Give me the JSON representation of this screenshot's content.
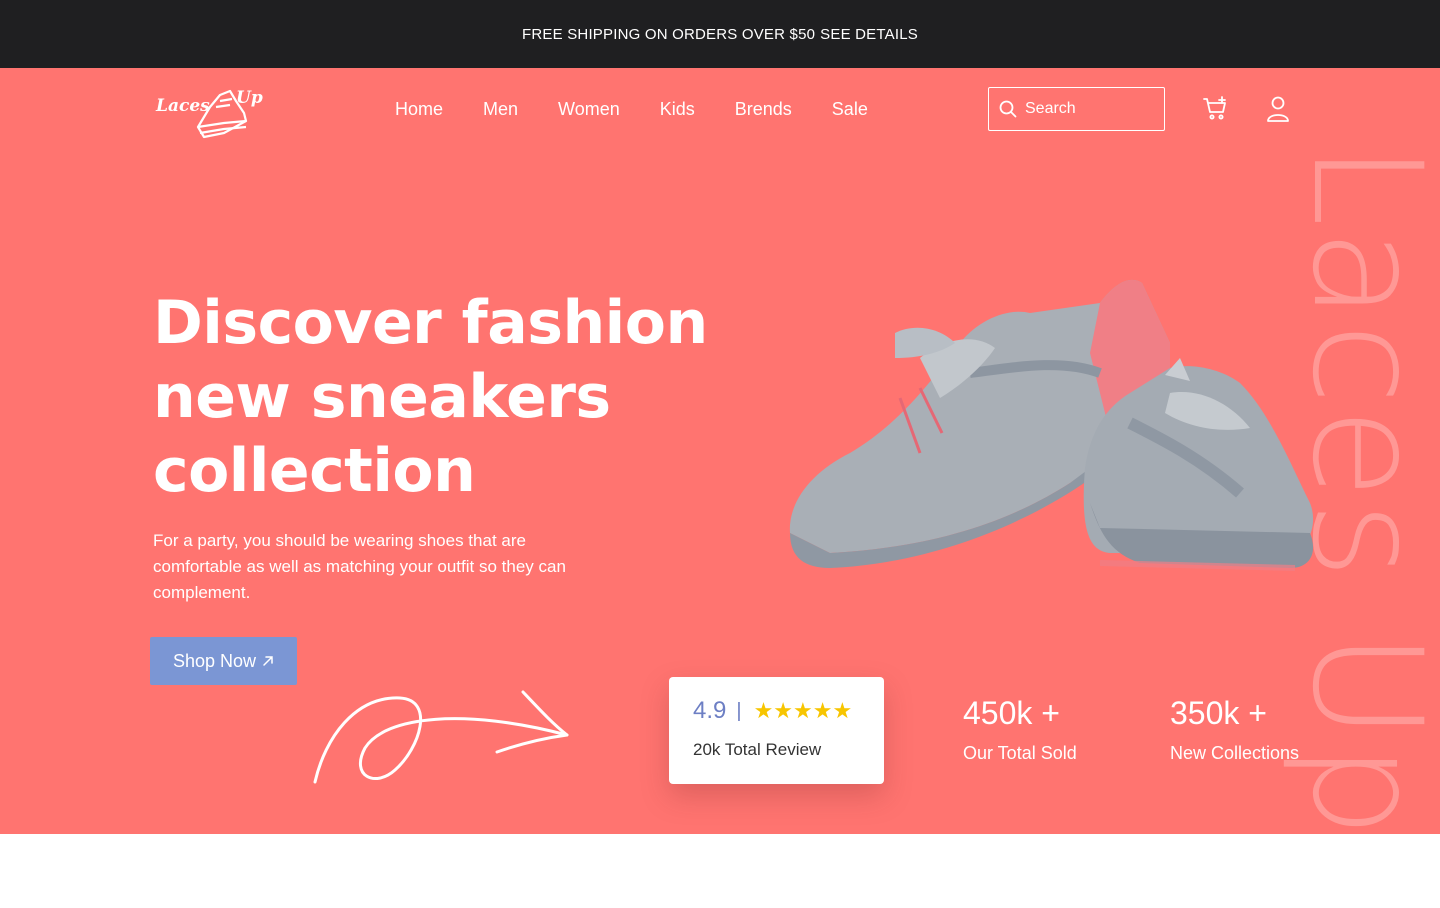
{
  "announcement": {
    "text": "FREE SHIPPING ON ORDERS OVER $50",
    "link": "SEE DETAILS"
  },
  "header": {
    "logo_text": "Laces Up",
    "nav": [
      "Home",
      "Men",
      "Women",
      "Kids",
      "Brends",
      "Sale"
    ],
    "search_placeholder": "Search"
  },
  "hero": {
    "title_line1": "Discover fashion",
    "title_line2": "new sneakers",
    "title_line3": "collection",
    "description": "For a party, you should be wearing shoes that are comfortable as well as matching your outfit so they can complement.",
    "cta_label": "Shop Now",
    "watermark": "Laces Up"
  },
  "review": {
    "rating": "4.9",
    "separator": "|",
    "stars": "★★★★★",
    "label": "20k Total Review"
  },
  "stats": [
    {
      "value": "450k +",
      "label": "Our Total Sold"
    },
    {
      "value": "350k +",
      "label": "New Collections"
    }
  ],
  "colors": {
    "hero_bg": "#ff7470",
    "topbar_bg": "#1f1f21",
    "button_bg": "#7b96d4",
    "star": "#f7c500",
    "rating_text": "#6d7fc4"
  }
}
